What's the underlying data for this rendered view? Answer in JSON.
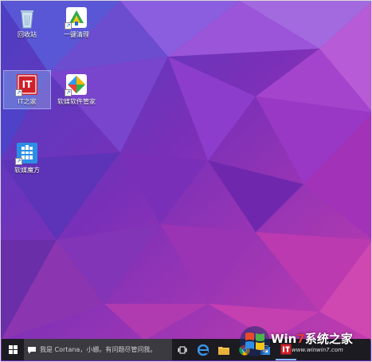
{
  "desktop": {
    "icons": [
      {
        "label": "回收站",
        "icon": "recycle-bin-icon"
      },
      {
        "label": "一键清理",
        "icon": "broom-cleanup-icon"
      },
      {
        "label": "IT之家",
        "icon": "ithome-icon",
        "icon_text": "IT"
      },
      {
        "label": "软媒软件管家",
        "icon": "software-manager-icon"
      },
      {
        "label": "软媒魔方",
        "icon": "rubik-cube-icon"
      }
    ]
  },
  "taskbar": {
    "start_icon": "windows-logo-icon",
    "search_placeholder": "我是 Cortana，小娜。有问题尽管问我。",
    "task_view_icon": "task-view-icon",
    "apps": [
      {
        "name": "edge",
        "icon": "edge-icon"
      },
      {
        "name": "file-explorer",
        "icon": "folder-icon"
      },
      {
        "name": "chrome",
        "icon": "chrome-icon"
      },
      {
        "name": "store",
        "icon": "store-icon"
      },
      {
        "name": "ithome",
        "icon": "ithome-icon"
      }
    ]
  },
  "watermark": {
    "brand_prefix": "Win",
    "brand_seven": "7",
    "brand_suffix": "系统之家",
    "url": "www.winwin7.com"
  },
  "colors": {
    "wallpaper_primary": "#6a2bb0",
    "wallpaper_accent": "#c43fb8",
    "taskbar": "#1c1b22",
    "search_box": "#3b3a41",
    "ithome_red": "#d0202a"
  }
}
